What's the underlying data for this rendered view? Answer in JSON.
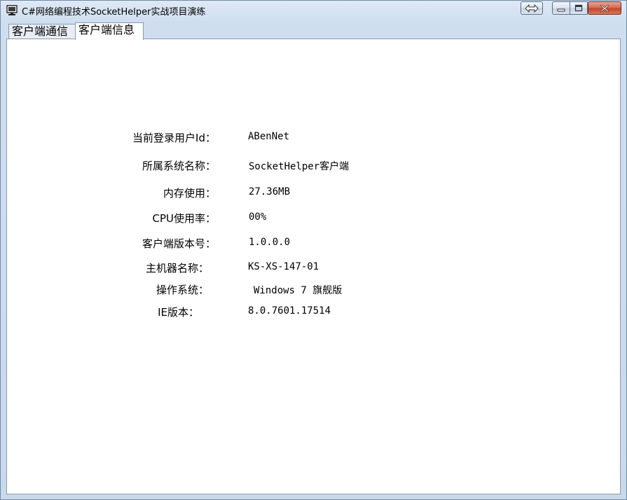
{
  "window": {
    "title": "C#网络编程技术SocketHelper实战项目演练",
    "icon": "monitor-app-icon"
  },
  "titlebar_buttons": {
    "resize_icon": "double-arrow-icon",
    "minimize_icon": "minimize-icon",
    "maximize_icon": "maximize-icon",
    "close_icon": "close-icon"
  },
  "tabs": [
    {
      "label": "客户端通信",
      "active": false
    },
    {
      "label": "客户端信息",
      "active": true
    }
  ],
  "info": [
    {
      "label": "当前登录用户Id：",
      "value": "ABenNet"
    },
    {
      "label": "所属系统名称：",
      "value": "SocketHelper客户端"
    },
    {
      "label": "内存使用：",
      "value": "27.36MB"
    },
    {
      "label": "CPU使用率：",
      "value": "00%"
    },
    {
      "label": "客户端版本号：",
      "value": "1.0.0.0"
    },
    {
      "label": "主机器名称：",
      "value": "KS-XS-147-01"
    },
    {
      "label": "操作系统：",
      "value": "Windows 7 旗舰版"
    },
    {
      "label": "IE版本：",
      "value": "8.0.7601.17514"
    }
  ],
  "colors": {
    "frame": "#c9d9ec",
    "close_button": "#c2462c",
    "panel_background": "#ffffff"
  }
}
